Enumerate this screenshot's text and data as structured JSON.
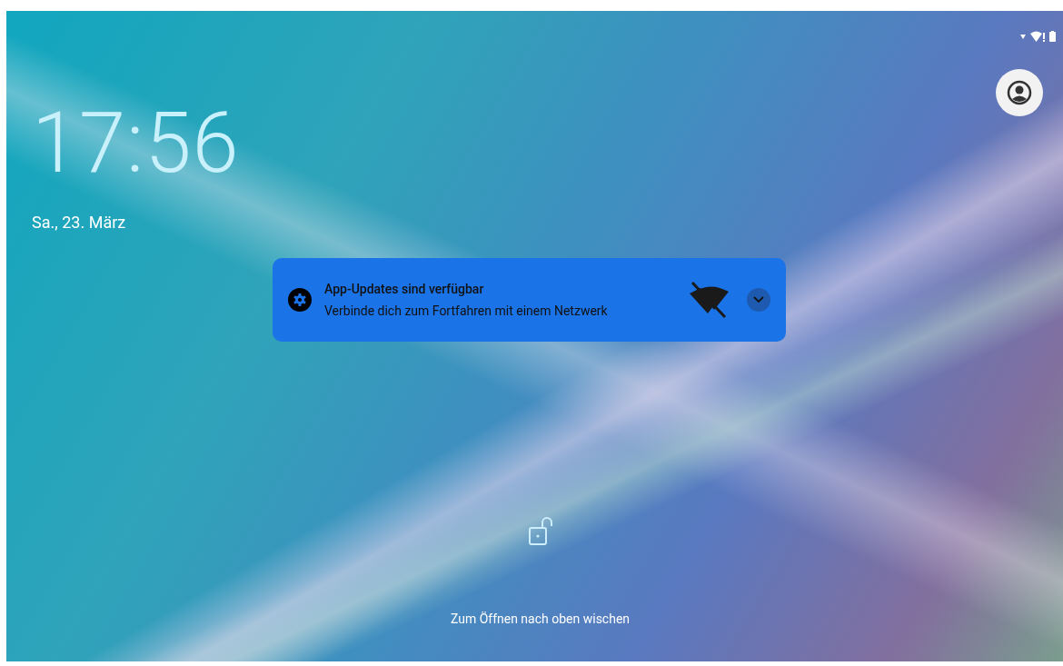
{
  "clock": {
    "time": "17:56",
    "date": "Sa., 23. März"
  },
  "notification": {
    "title": "App-Updates sind verfügbar",
    "text": "Verbinde dich zum Fortfahren mit einem Netzwerk",
    "expanded": false
  },
  "unlock_hint": "Zum Öffnen nach oben wischen"
}
